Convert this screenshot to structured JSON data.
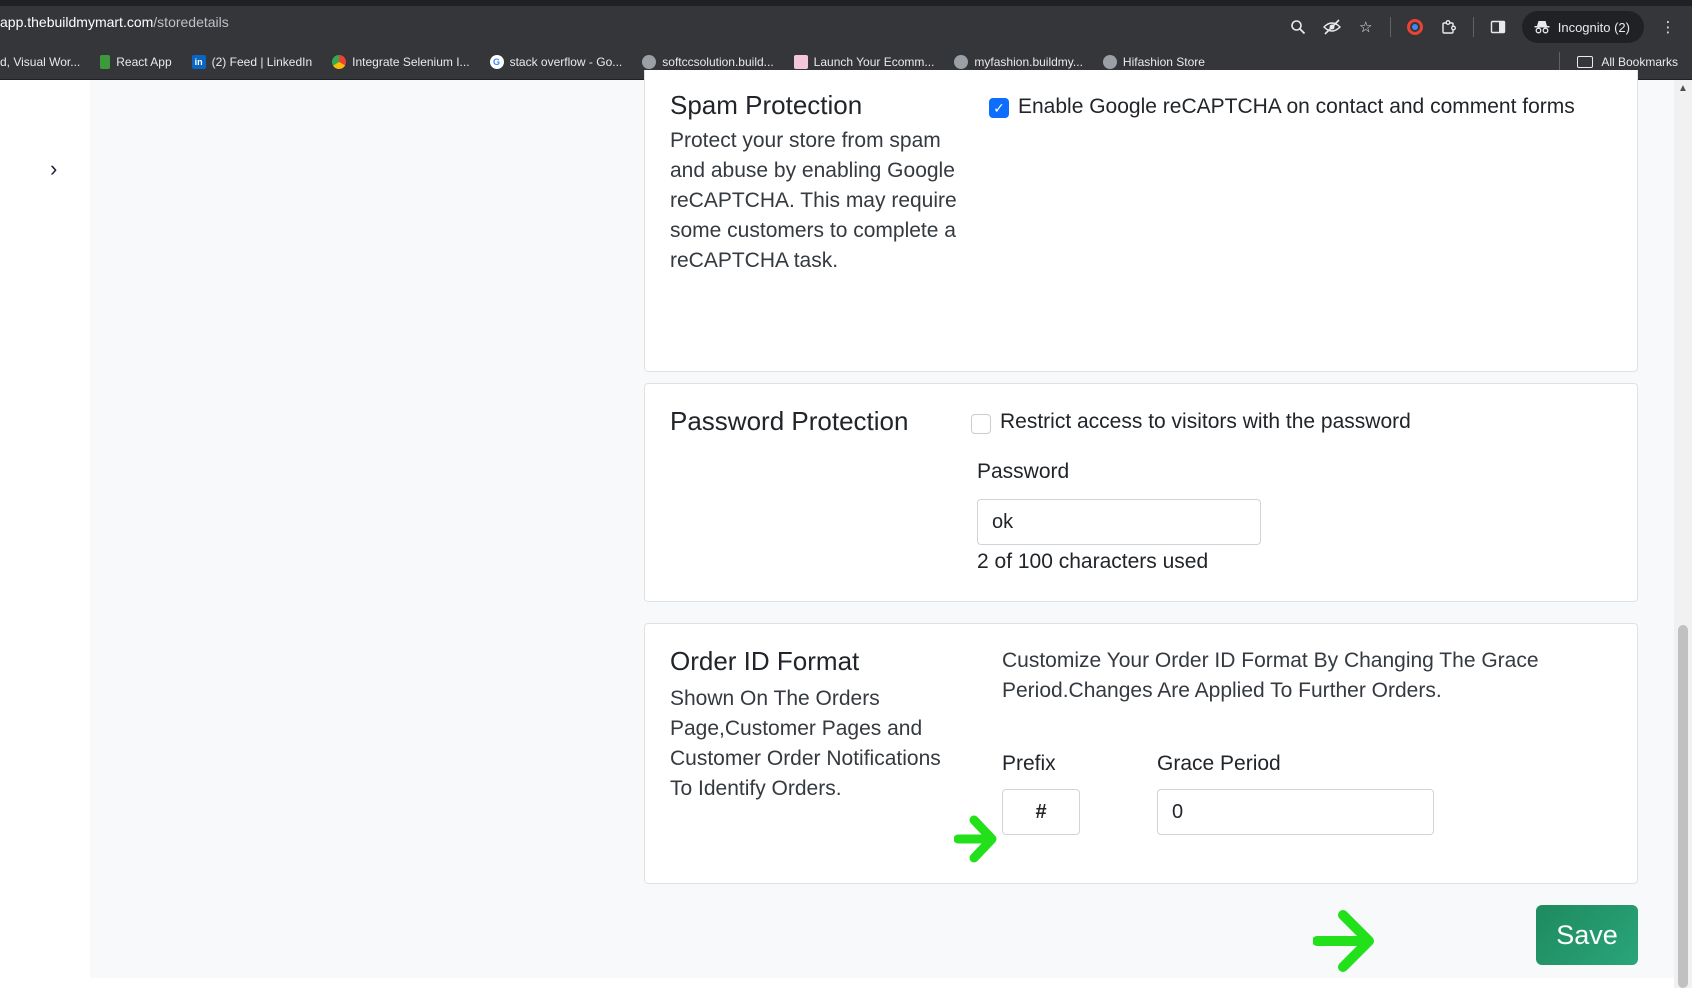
{
  "browser": {
    "url_host": "app.thebuildmymart.com",
    "url_path": "/storedetails",
    "incognito_label": "Incognito (2)",
    "bookmarks": [
      {
        "label": "d, Visual Wor...",
        "icon": "none"
      },
      {
        "label": "React App",
        "icon": "react"
      },
      {
        "label": "(2) Feed | LinkedIn",
        "icon": "linkedin"
      },
      {
        "label": "Integrate Selenium I...",
        "icon": "chrome"
      },
      {
        "label": "stack overflow - Go...",
        "icon": "google"
      },
      {
        "label": "softccsolution.build...",
        "icon": "globe"
      },
      {
        "label": "Launch Your Ecomm...",
        "icon": "shop"
      },
      {
        "label": "myfashion.buildmy...",
        "icon": "globe"
      },
      {
        "label": "Hifashion Store",
        "icon": "globe"
      }
    ],
    "all_bookmarks_label": "All Bookmarks"
  },
  "spam": {
    "title": "Spam Protection",
    "description": "Protect your store from spam and abuse by enabling Google reCAPTCHA. This may require some customers to complete a reCAPTCHA task.",
    "checkbox_label": "Enable Google reCAPTCHA on contact and comment forms",
    "checked": true
  },
  "password": {
    "title": "Password Protection",
    "checkbox_label": "Restrict access to visitors with the password",
    "checked": false,
    "field_label": "Password",
    "field_value": "ok",
    "char_count": "2 of 100 characters used"
  },
  "order_id": {
    "title": "Order ID Format",
    "description": "Shown On The Orders Page,Customer Pages and Customer Order Notifications To Identify Orders.",
    "info": "Customize Your Order ID Format By Changing The Grace Period.Changes Are Applied To Further Orders.",
    "prefix_label": "Prefix",
    "prefix_value": "#",
    "grace_label": "Grace Period",
    "grace_value": "0"
  },
  "actions": {
    "save_label": "Save"
  },
  "colors": {
    "accent": "#0d6efd",
    "save_button": "#1e8a5f",
    "arrow": "#22e01a"
  }
}
